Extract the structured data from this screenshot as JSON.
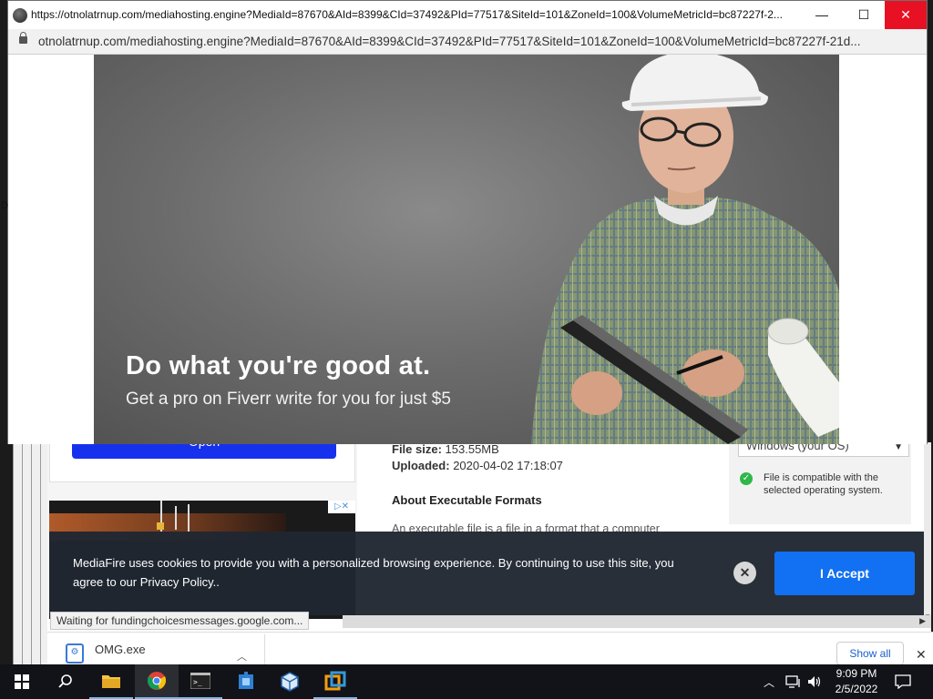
{
  "popup": {
    "title": "https://otnolatrnup.com/mediahosting.engine?MediaId=87670&AId=8399&CId=37492&PId=77517&SiteId=101&ZoneId=100&VolumeMetricId=bc87227f-2...",
    "url": "otnolatrnup.com/mediahosting.engine?MediaId=87670&AId=8399&CId=37492&PId=77517&SiteId=101&ZoneId=100&VolumeMetricId=bc87227f-21d...",
    "controls": {
      "minimize": "—",
      "maximize": "☐",
      "close": "✕"
    },
    "left_stub": "D",
    "ad": {
      "headline": "Do what you're good at.",
      "subline": "Get a pro on Fiverr write for you for just $5"
    }
  },
  "background_page": {
    "open_button": "Open",
    "file_size_label": "File size:",
    "file_size_value": "153.55MB",
    "uploaded_label": "Uploaded:",
    "uploaded_value": "2020-04-02 17:18:07",
    "about_heading": "About Executable Formats",
    "about_text": "An executable file is a file in a format that a computer",
    "os_select": "Windows (your OS)",
    "compat_text": "File is compatible with the selected operating system.",
    "ad_choices": "▷✕"
  },
  "cookie_banner": {
    "message": "MediaFire uses cookies to provide you with a personalized browsing experience. By continuing to use this site, you agree to our Privacy Policy..",
    "close_label": "✕",
    "accept_label": "I Accept"
  },
  "status_bar": {
    "text": "Waiting for fundingchoicesmessages.google.com..."
  },
  "download_shelf": {
    "file_name": "OMG.exe",
    "show_all": "Show all",
    "close": "✕"
  },
  "taskbar": {
    "time": "9:09 PM",
    "date": "2/5/2022",
    "icons": [
      "windows-start-icon",
      "search-icon",
      "file-explorer-icon",
      "chrome-icon",
      "terminal-icon",
      "network-tool-icon",
      "virtualbox-icon",
      "app-icon"
    ]
  }
}
